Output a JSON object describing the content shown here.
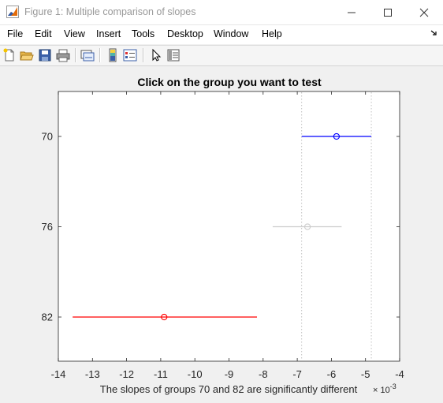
{
  "window": {
    "title": "Figure 1: Multiple comparison of slopes",
    "icon": "matlab-figure-icon"
  },
  "menu": [
    "File",
    "Edit",
    "View",
    "Insert",
    "Tools",
    "Desktop",
    "Window",
    "Help"
  ],
  "toolbar": [
    "new-figure-icon",
    "open-file-icon",
    "save-icon",
    "print-icon",
    "link-plot-icon",
    "insert-colorbar-icon",
    "insert-legend-icon",
    "edit-plot-arrow-icon",
    "property-inspector-icon"
  ],
  "chart_data": {
    "type": "errorbar",
    "title": "Click on the group you want to test",
    "xlabel": "The slopes of groups 70 and 82 are significantly different",
    "x_exponent_label": "× 10",
    "x_exponent_power": "-3",
    "xlim": [
      -14,
      -4
    ],
    "x_scale": 0.001,
    "x_ticks": [
      -14,
      -13,
      -12,
      -11,
      -10,
      -9,
      -8,
      -7,
      -6,
      -5,
      -4
    ],
    "y_categories": [
      "70",
      "76",
      "82"
    ],
    "groups": [
      {
        "name": "70",
        "mean": -5.85,
        "lower": -6.87,
        "upper": -4.83,
        "color": "#0000ff",
        "role": "selected"
      },
      {
        "name": "76",
        "mean": -6.7,
        "lower": -7.72,
        "upper": -5.7,
        "color": "#cccccc",
        "role": "not significantly different"
      },
      {
        "name": "82",
        "mean": -10.9,
        "lower": -13.58,
        "upper": -8.18,
        "color": "#ff0000",
        "role": "significantly different"
      }
    ],
    "reference_lines": [
      -6.87,
      -4.83
    ],
    "grid": false,
    "legend": "none"
  }
}
